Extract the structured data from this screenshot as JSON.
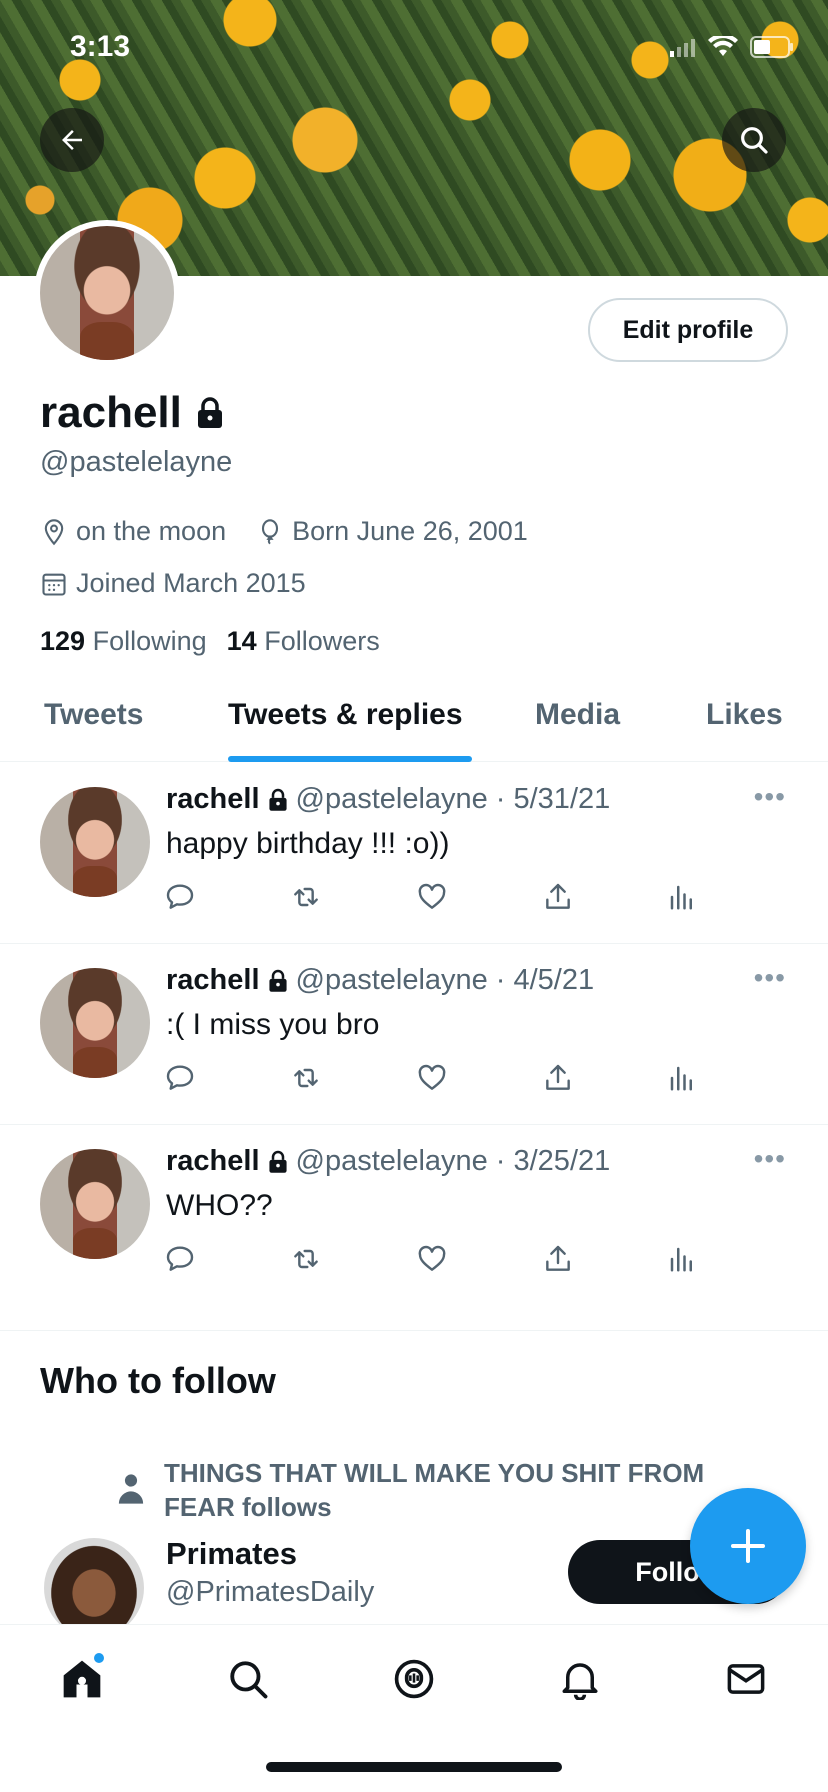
{
  "status_bar": {
    "time": "3:13"
  },
  "profile": {
    "edit_label": "Edit profile",
    "name": "rachell",
    "handle": "@pastelelayne",
    "location": "on the moon",
    "birthday": "Born June 26, 2001",
    "joined": "Joined March 2015",
    "following_count": "129",
    "following_label": "Following",
    "followers_count": "14",
    "followers_label": "Followers"
  },
  "tabs": [
    {
      "label": "Tweets"
    },
    {
      "label": "Tweets & replies",
      "active": true
    },
    {
      "label": "Media"
    },
    {
      "label": "Likes"
    }
  ],
  "tweets": [
    {
      "name": "rachell",
      "handle": "@pastelelayne",
      "date": "· 5/31/21",
      "text": "happy birthday !!! :o))"
    },
    {
      "name": "rachell",
      "handle": "@pastelelayne",
      "date": "· 4/5/21",
      "text": ":( I miss you bro"
    },
    {
      "name": "rachell",
      "handle": "@pastelelayne",
      "date": "· 3/25/21",
      "text": "WHO??"
    }
  ],
  "who_to_follow": {
    "title": "Who to follow",
    "context": "THINGS THAT WILL MAKE YOU SHIT FROM FEAR follows",
    "suggestion": {
      "name": "Primates",
      "handle": "@PrimatesDaily",
      "button": "Follow"
    }
  },
  "colors": {
    "accent": "#1d9bf0",
    "text": "#0f1419",
    "secondary": "#536471"
  }
}
